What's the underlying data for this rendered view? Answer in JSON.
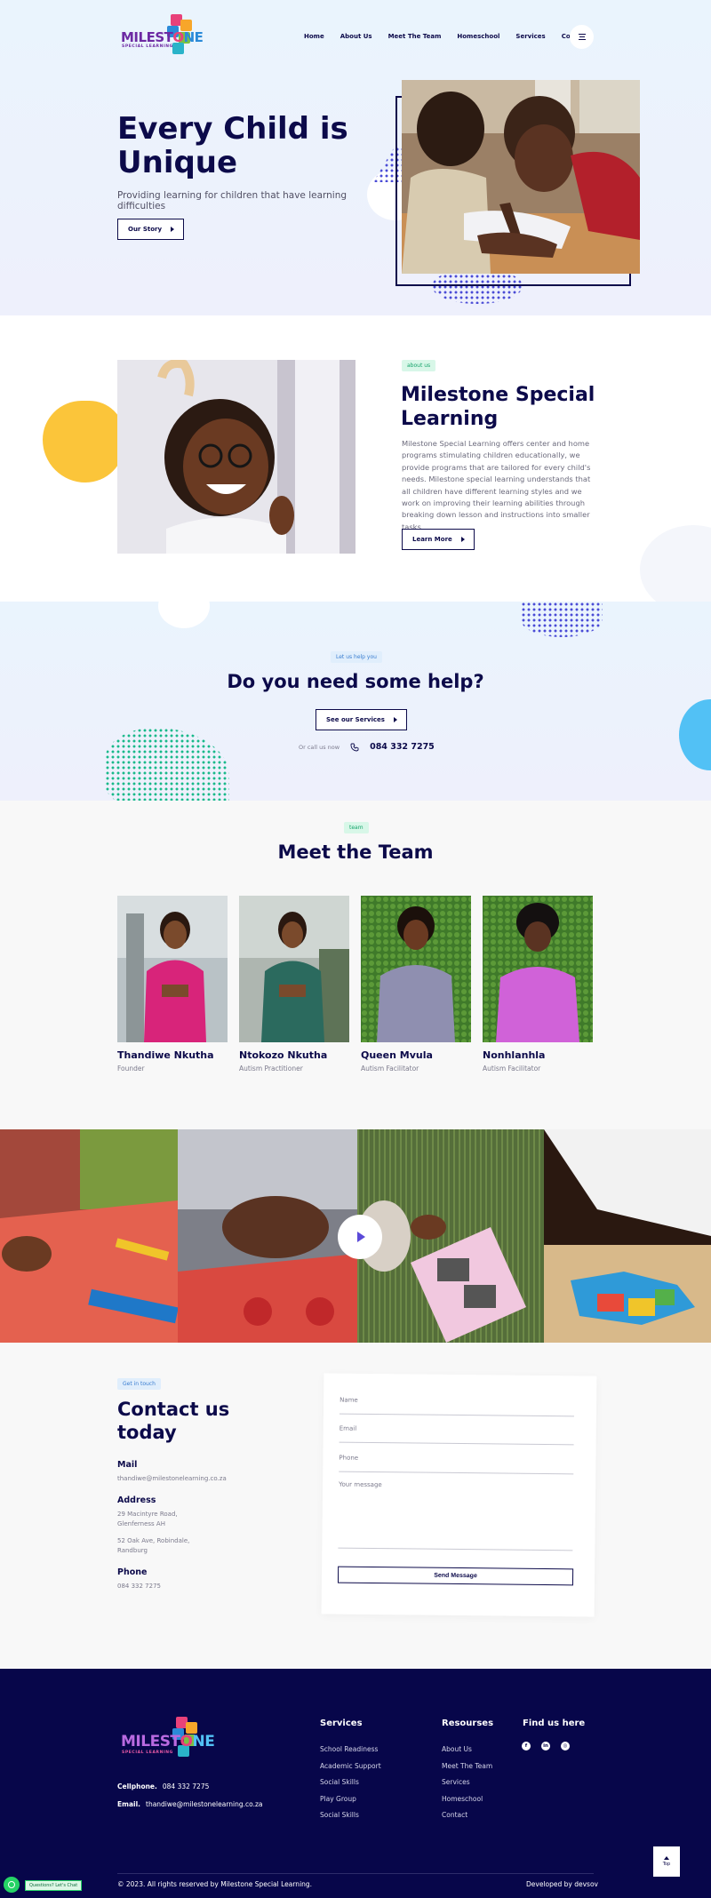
{
  "brand": {
    "logo_word": "MILESTONE",
    "logo_sub": "SPECIAL LEARNING",
    "colors": {
      "navy": "#0c0a4a",
      "yellow": "#fbc53a",
      "blue": "#52c1f5",
      "green": "#15a36a",
      "purple": "#6d2aa3"
    }
  },
  "nav": {
    "items": [
      "Home",
      "About Us",
      "Meet The Team",
      "Homeschool",
      "Services",
      "Contact"
    ],
    "menu_icon": "hamburger-icon"
  },
  "hero": {
    "title": "Every Child is Unique",
    "subtitle": "Providing learning for children that have learning difficulties",
    "button": "Our Story"
  },
  "about": {
    "tag": "about us",
    "title": "Milestone Special Learning",
    "text": "Milestone Special Learning offers center and home programs stimulating children educationally, we provide programs that are tailored for every child's needs. Milestone special learning understands that all children have different learning styles and we work on improving their learning abilities through breaking down lesson and instructions into smaller tasks.",
    "button": "Learn More"
  },
  "help": {
    "tag": "Let us help you",
    "title": "Do you need some help?",
    "button": "See our Services",
    "call_prefix": "Or call us now",
    "phone": "084 332 7275"
  },
  "team": {
    "tag": "team",
    "title": "Meet the Team",
    "members": [
      {
        "name": "Thandiwe Nkutha",
        "role": "Founder"
      },
      {
        "name": "Ntokozo Nkutha",
        "role": "Autism Practitioner"
      },
      {
        "name": "Queen Mvula",
        "role": "Autism Facilitator"
      },
      {
        "name": "Nonhlanhla",
        "role": "Autism Facilitator"
      }
    ]
  },
  "contact": {
    "tag": "Get in touch",
    "title": "Contact us today",
    "mail_label": "Mail",
    "mail": "thandiwe@milestonelearning.co.za",
    "address_label": "Address",
    "address1_line1": "29 Macintyre Road,",
    "address1_line2": "Glenferness AH",
    "address2_line1": "52 Oak Ave, Robindale,",
    "address2_line2": "Randburg",
    "phone_label": "Phone",
    "phone": "084 332 7275",
    "form": {
      "name": "Name",
      "email": "Email",
      "phone": "Phone",
      "message": "Your message",
      "submit": "Send Message"
    }
  },
  "footer": {
    "cellphone_label": "Cellphone.",
    "cellphone": "084 332 7275",
    "email_label": "Email.",
    "email": "thandiwe@milestonelearning.co.za",
    "services_title": "Services",
    "services": [
      "School Readiness",
      "Academic Support",
      "Social Skills",
      "Play Group",
      "Social Skills"
    ],
    "resources_title": "Resourses",
    "resources": [
      "About Us",
      "Meet The Team",
      "Services",
      "Homeschool",
      "Contact"
    ],
    "find_title": "Find us here",
    "socials": [
      "facebook-icon",
      "linkedin-icon",
      "instagram-icon"
    ],
    "copyright": "© 2023. All rights reserved by Milestone Special Learning.",
    "developer": "Developed by devsov",
    "top_label": "Top"
  },
  "whatsapp": {
    "label": "Questions? Let's Chat"
  }
}
